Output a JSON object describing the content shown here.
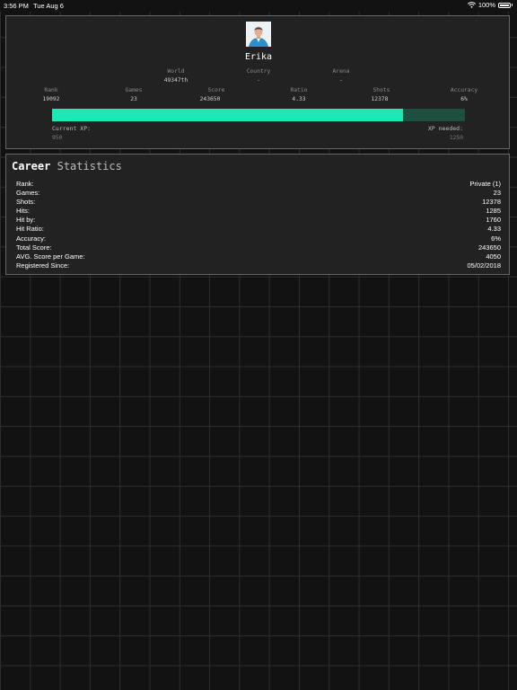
{
  "status_bar": {
    "time": "3:56 PM",
    "date": "Tue Aug 6",
    "battery": "100%"
  },
  "profile": {
    "name": "Erika",
    "location": [
      {
        "label": "World",
        "value": "49347th"
      },
      {
        "label": "Country",
        "value": "-"
      },
      {
        "label": "Arena",
        "value": "-"
      }
    ],
    "stats": [
      {
        "label": "Rank",
        "value": "19092"
      },
      {
        "label": "Games",
        "value": "23"
      },
      {
        "label": "Score",
        "value": "243650"
      },
      {
        "label": "Ratio",
        "value": "4.33"
      },
      {
        "label": "Shots",
        "value": "12378"
      },
      {
        "label": "Accuracy",
        "value": "6%"
      }
    ],
    "xp": {
      "current_label": "Current XP:",
      "current_value": "950",
      "needed_label": "XP needed:",
      "needed_value": "1250",
      "progress_percent": 85,
      "fill_color": "#1de9b6",
      "track_color": "#1f4f40"
    }
  },
  "career": {
    "title_word1": "Career",
    "title_word2": "Statistics",
    "rows": [
      {
        "label": "Rank:",
        "value": "Private (1)"
      },
      {
        "label": "Games:",
        "value": "23"
      },
      {
        "label": "Shots:",
        "value": "12378"
      },
      {
        "label": "Hits:",
        "value": "1285"
      },
      {
        "label": "Hit by:",
        "value": "1760"
      },
      {
        "label": "Hit Ratio:",
        "value": "4.33"
      },
      {
        "label": "Accuracy:",
        "value": "6%"
      },
      {
        "label": "Total Score:",
        "value": "243650"
      },
      {
        "label": "AVG. Score per Game:",
        "value": "4050"
      },
      {
        "label": "Registered Since:",
        "value": "05/02/2018"
      }
    ]
  }
}
